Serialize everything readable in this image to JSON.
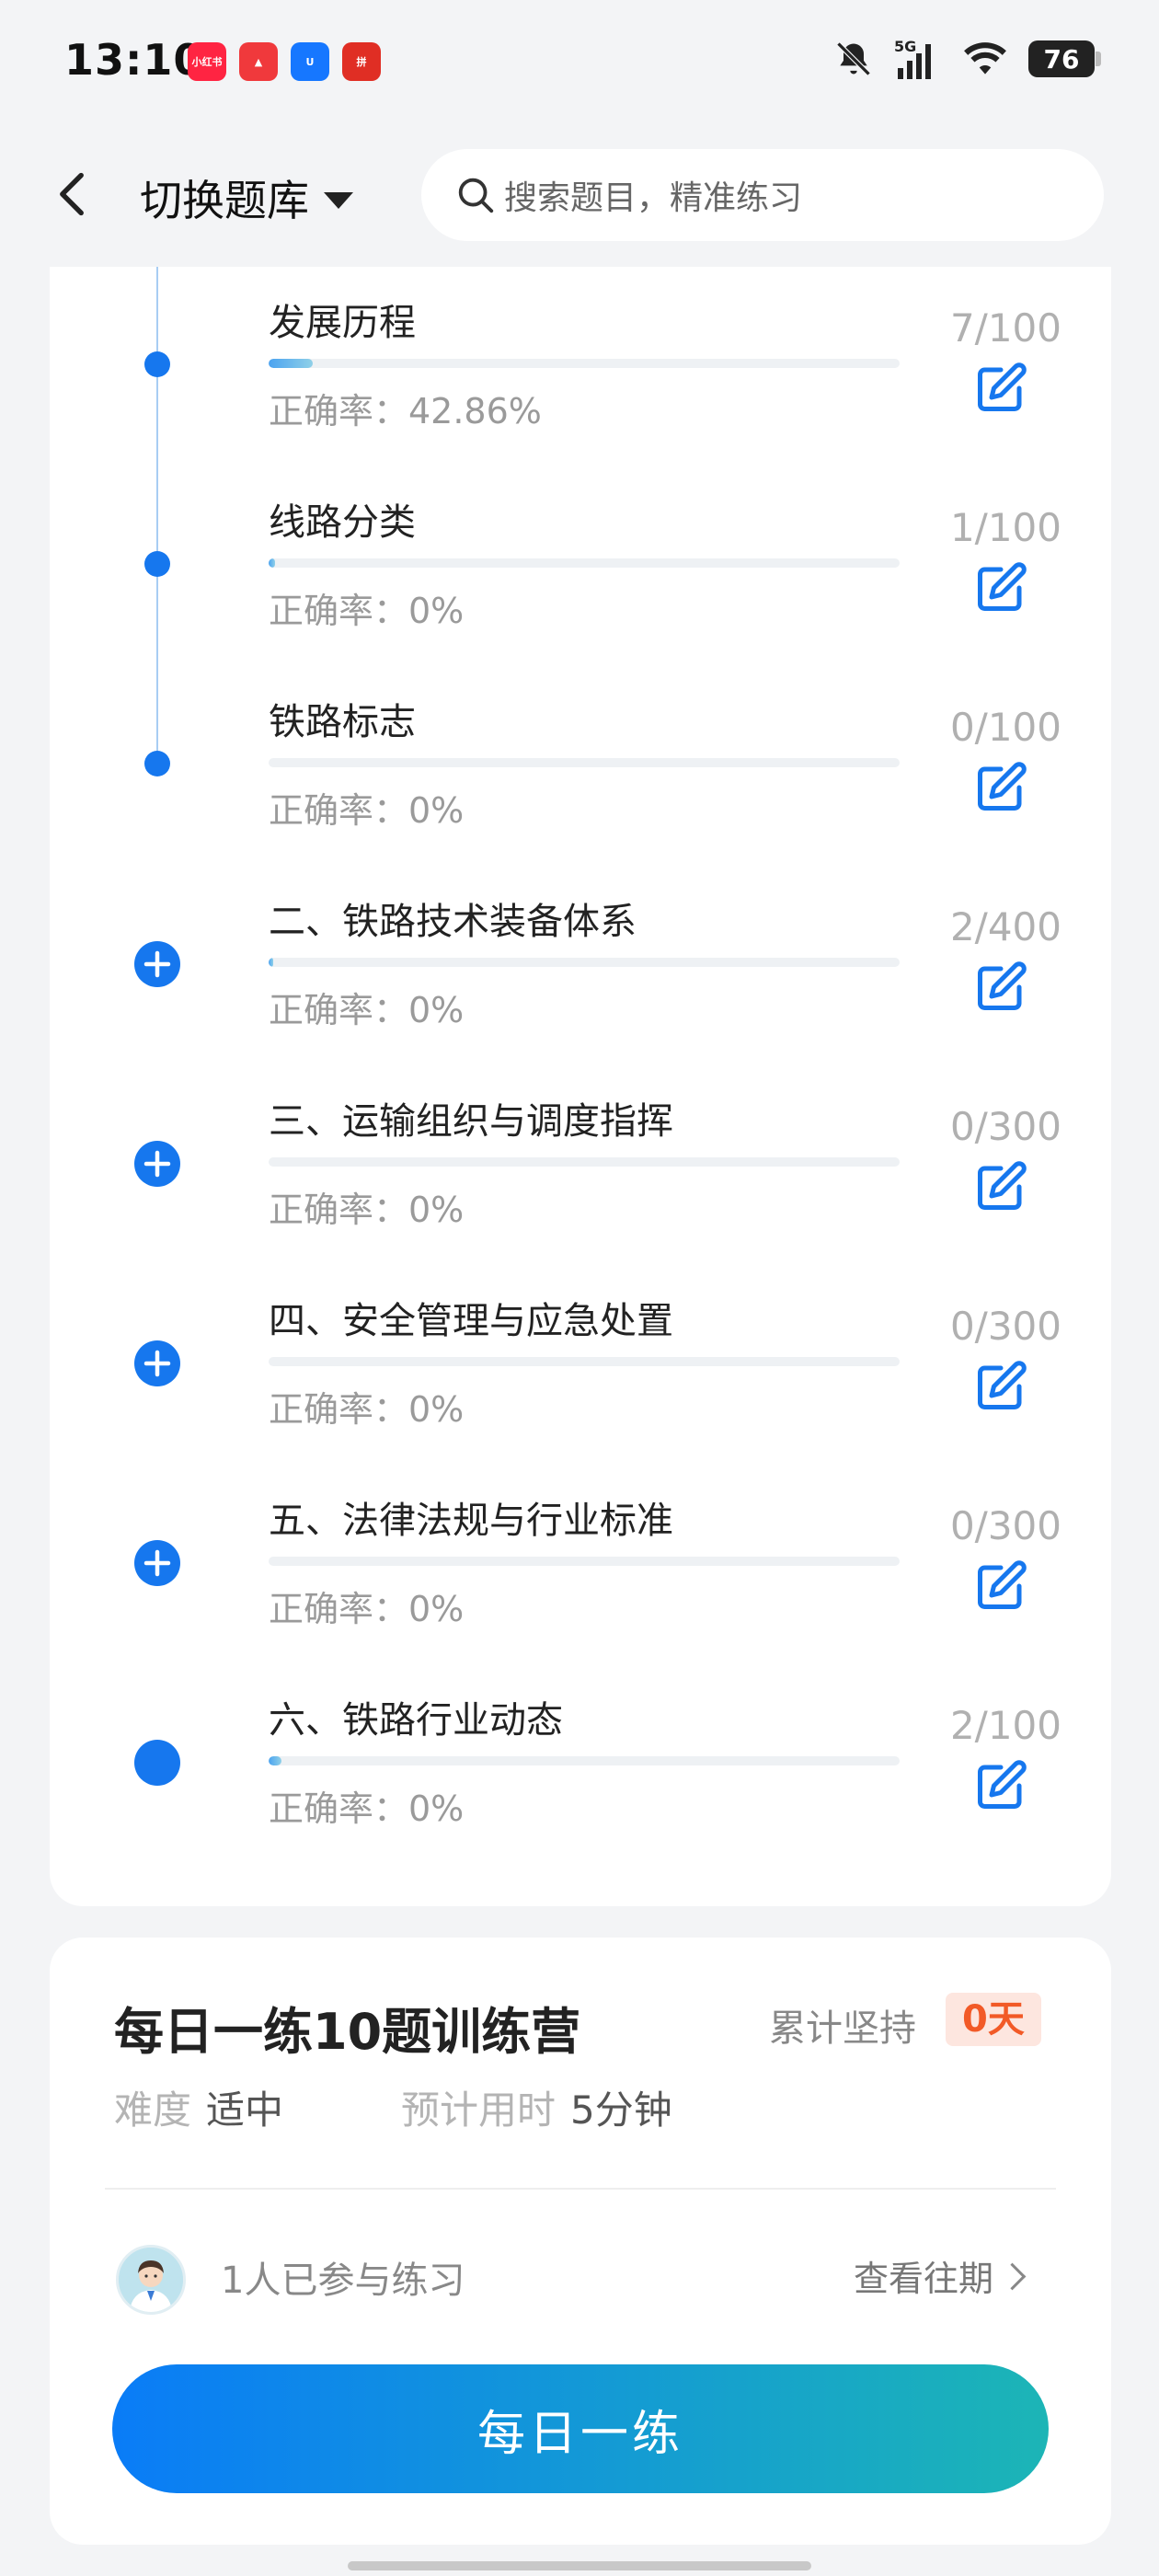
{
  "status_bar": {
    "time": "13:10",
    "app_icons": [
      {
        "name": "xiaohongshu-icon",
        "label": "小红书",
        "color": "#ff2442"
      },
      {
        "name": "app-red-icon",
        "label": "▲",
        "color": "#f0393c"
      },
      {
        "name": "app-blue-icon",
        "label": "U",
        "color": "#1677ff"
      },
      {
        "name": "app-pdd-icon",
        "label": "拼",
        "color": "#e02e24"
      }
    ],
    "network": "5G",
    "battery": "76"
  },
  "header": {
    "title": "切换题库",
    "search_placeholder": "搜索题目，精准练习"
  },
  "chapters": [
    {
      "title": "发展历程",
      "progress": 0.07,
      "accuracy": "正确率：42.86%",
      "count": "7/100",
      "marker": "dot"
    },
    {
      "title": "线路分类",
      "progress": 0.01,
      "accuracy": "正确率：0%",
      "count": "1/100",
      "marker": "dot"
    },
    {
      "title": "铁路标志",
      "progress": 0.0,
      "accuracy": "正确率：0%",
      "count": "0/100",
      "marker": "dot"
    },
    {
      "title": "二、铁路技术装备体系",
      "progress": 0.005,
      "accuracy": "正确率：0%",
      "count": "2/400",
      "marker": "plus"
    },
    {
      "title": "三、运输组织与调度指挥",
      "progress": 0.0,
      "accuracy": "正确率：0%",
      "count": "0/300",
      "marker": "plus"
    },
    {
      "title": "四、安全管理与应急处置",
      "progress": 0.0,
      "accuracy": "正确率：0%",
      "count": "0/300",
      "marker": "plus"
    },
    {
      "title": "五、法律法规与行业标准",
      "progress": 0.0,
      "accuracy": "正确率：0%",
      "count": "0/300",
      "marker": "plus"
    },
    {
      "title": "六、铁路行业动态",
      "progress": 0.02,
      "accuracy": "正确率：0%",
      "count": "2/100",
      "marker": "big-dot"
    }
  ],
  "training": {
    "title": "每日一练10题训练营",
    "persist_label": "累计坚持",
    "persist_value": "0天",
    "difficulty_label": "难度",
    "difficulty_value": "适中",
    "time_label": "预计用时",
    "time_value": "5分钟",
    "participants": "1人已参与练习",
    "history_link": "查看往期",
    "button": "每日一练"
  },
  "colors": {
    "accent": "#1677ee",
    "badge_text": "#f25a27",
    "button_gradient": [
      "#0a7cf7",
      "#1cb5b6"
    ]
  }
}
